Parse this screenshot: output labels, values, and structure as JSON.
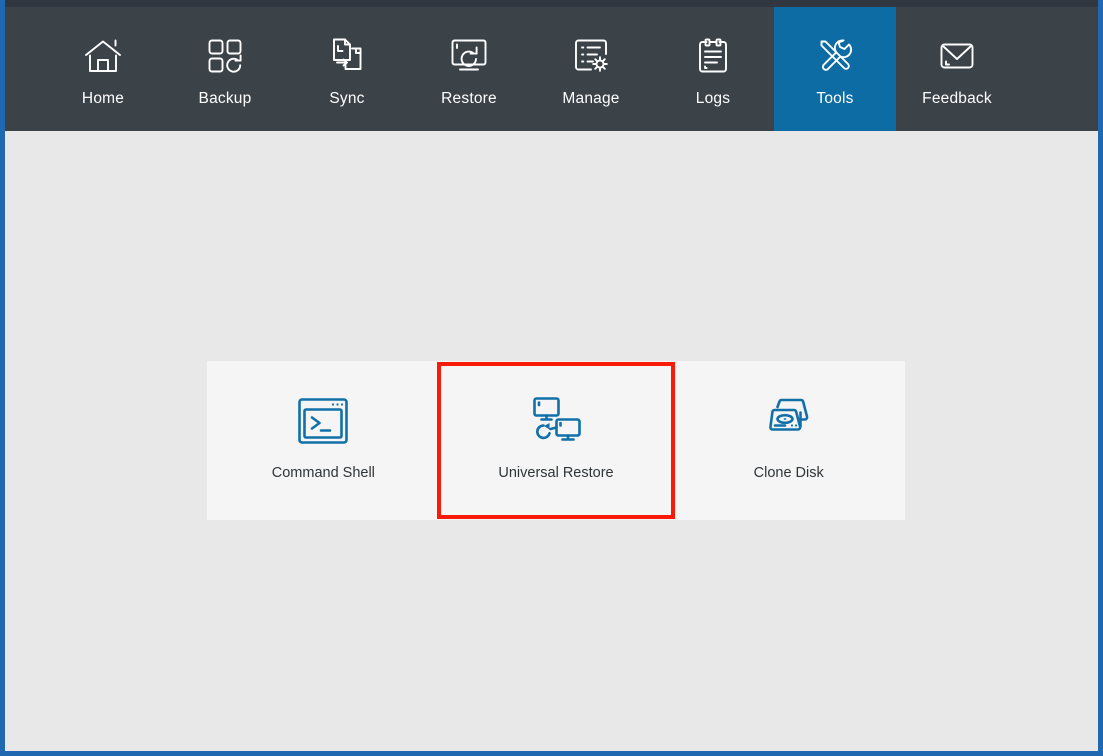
{
  "window": {
    "border_color": "#2069b0",
    "top_strip_color": "#313740",
    "content_background": "#e8e8e8"
  },
  "navbar": {
    "background": "#3b4248",
    "active_color": "#0c6ca3",
    "items": [
      {
        "label": "Home",
        "icon": "home-icon",
        "active": false
      },
      {
        "label": "Backup",
        "icon": "backup-icon",
        "active": false
      },
      {
        "label": "Sync",
        "icon": "sync-icon",
        "active": false
      },
      {
        "label": "Restore",
        "icon": "restore-icon",
        "active": false
      },
      {
        "label": "Manage",
        "icon": "manage-icon",
        "active": false
      },
      {
        "label": "Logs",
        "icon": "logs-icon",
        "active": false
      },
      {
        "label": "Tools",
        "icon": "tools-icon",
        "active": true
      },
      {
        "label": "Feedback",
        "icon": "feedback-icon",
        "active": false
      }
    ]
  },
  "tools": {
    "panel_background": "#f5f5f5",
    "accent_color": "#1270a8",
    "highlight_color": "#f71b08",
    "cards": [
      {
        "label": "Command Shell",
        "icon": "command-shell-icon",
        "highlighted": false
      },
      {
        "label": "Universal Restore",
        "icon": "universal-restore-icon",
        "highlighted": true
      },
      {
        "label": "Clone Disk",
        "icon": "clone-disk-icon",
        "highlighted": false
      }
    ]
  }
}
